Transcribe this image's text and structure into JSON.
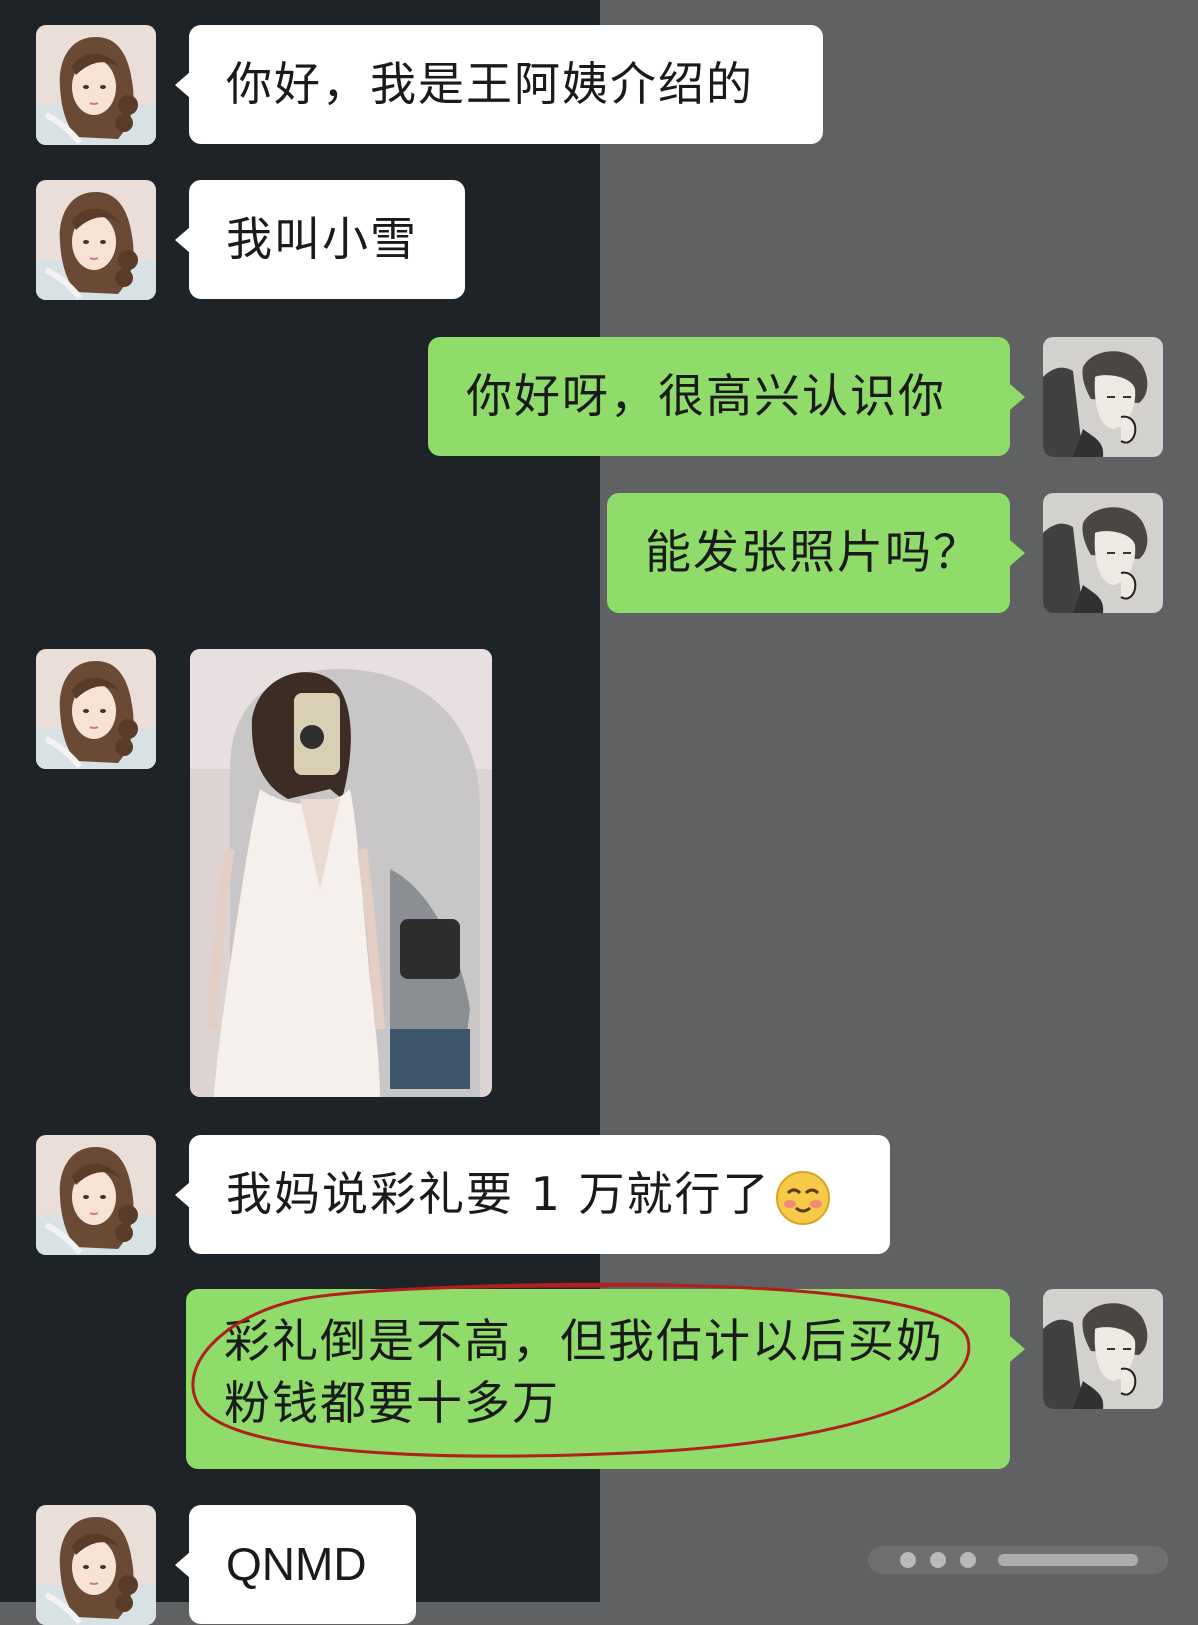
{
  "chat": {
    "messages": [
      {
        "sender": "incoming",
        "text": "你好，我是王阿姨介绍的"
      },
      {
        "sender": "incoming",
        "text": "我叫小雪"
      },
      {
        "sender": "outgoing",
        "text": "你好呀，很高兴认识你"
      },
      {
        "sender": "outgoing",
        "text": "能发张照片吗？"
      },
      {
        "sender": "incoming",
        "type": "photo"
      },
      {
        "sender": "incoming",
        "text": "我妈说彩礼要 1 万就行了",
        "emoji": "shy-smile-emoji"
      },
      {
        "sender": "outgoing",
        "text_line1": "彩礼倒是不高，但我估计以后买奶",
        "text_line2": "粉钱都要十多万",
        "annotation": "red-circle"
      },
      {
        "sender": "incoming",
        "text": "QNMD"
      }
    ]
  },
  "colors": {
    "left_bg": "#1d2327",
    "right_bg": "#5f6163",
    "incoming_bubble": "#ffffff",
    "outgoing_bubble": "#8fdc6b",
    "annotation_red": "#b0201c"
  },
  "icons": {
    "incoming_avatar": "female-anime-avatar",
    "outgoing_avatar": "male-anime-avatar"
  }
}
